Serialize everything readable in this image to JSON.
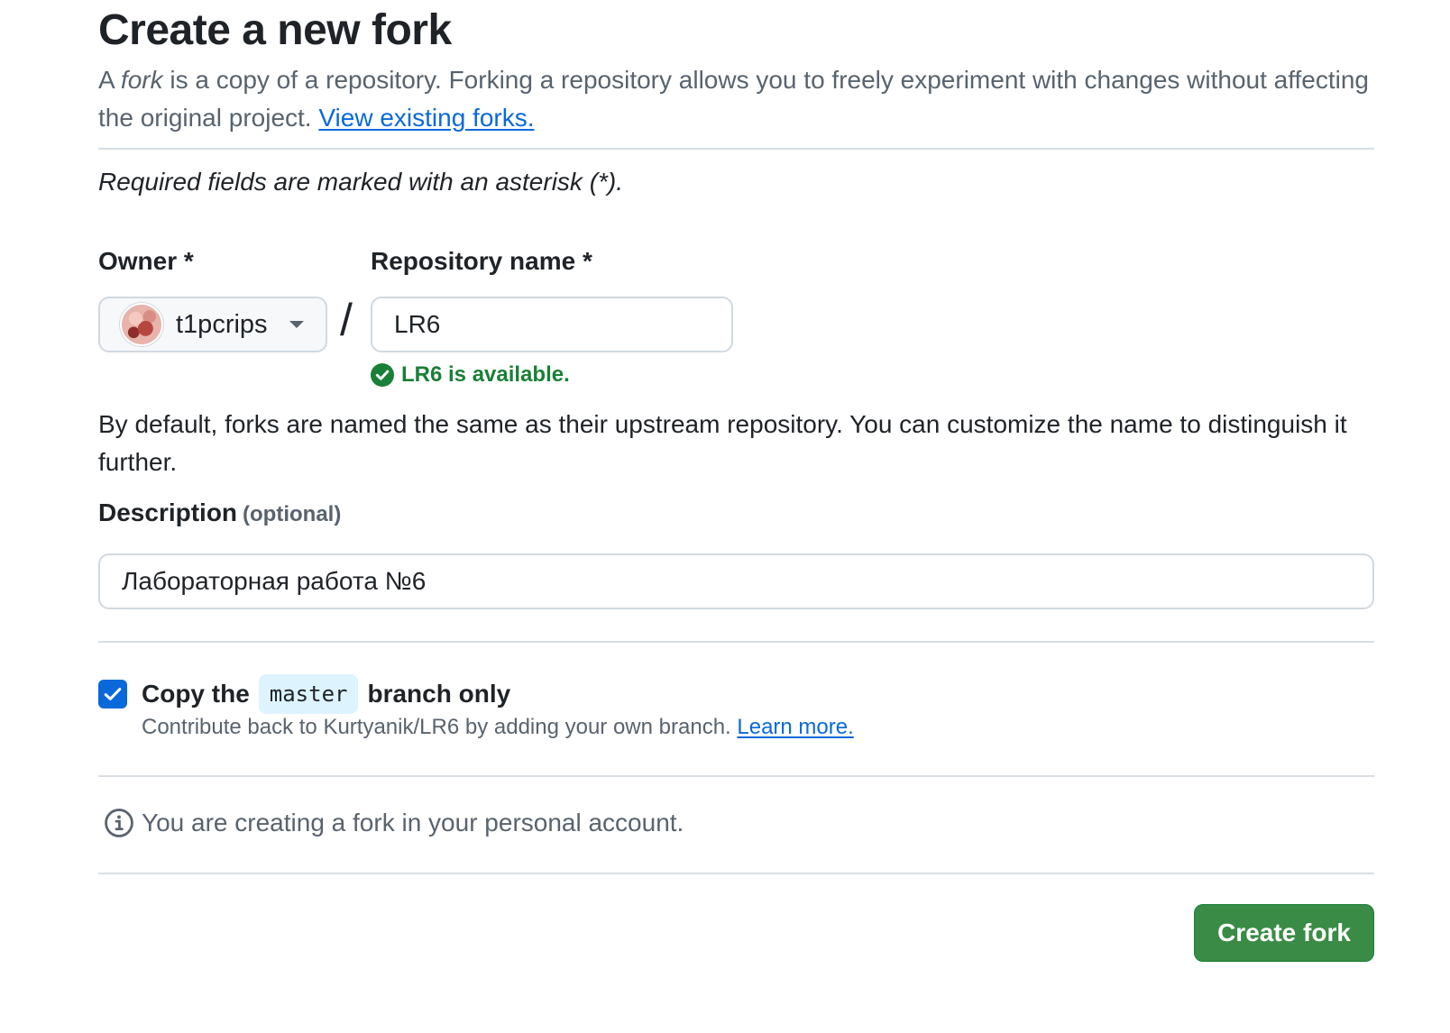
{
  "page_title": "Create a new fork",
  "intro": {
    "prefix": "A ",
    "fork_word": "fork",
    "text": " is a copy of a repository. Forking a repository allows you to freely experiment with changes without affecting the original project. ",
    "link": "View existing forks."
  },
  "required_note": "Required fields are marked with an asterisk (*).",
  "owner": {
    "label": "Owner *",
    "value": "t1pcrips"
  },
  "separator": "/",
  "repository": {
    "label": "Repository name *",
    "value": "LR6",
    "availability": "LR6 is available."
  },
  "default_note": "By default, forks are named the same as their upstream repository. You can customize the name to distinguish it further.",
  "description": {
    "label": "Description",
    "optional": "(optional)",
    "value": "Лабораторная работа №6"
  },
  "copy_branch": {
    "checked": true,
    "label_before": "Copy the",
    "branch": "master",
    "label_after": "branch only",
    "hint": "Contribute back to Kurtyanik/LR6 by adding your own branch. ",
    "learn_more": "Learn more."
  },
  "info_message": "You are creating a fork in your personal account.",
  "create_button": "Create fork",
  "colors": {
    "accent": "#0969da",
    "success": "#1a7f37",
    "button": "#3a8b45"
  },
  "icons": {
    "owner_caret": "triangle-down-icon",
    "availability": "check-circle-icon",
    "checkbox": "check-icon",
    "info": "info-icon"
  }
}
